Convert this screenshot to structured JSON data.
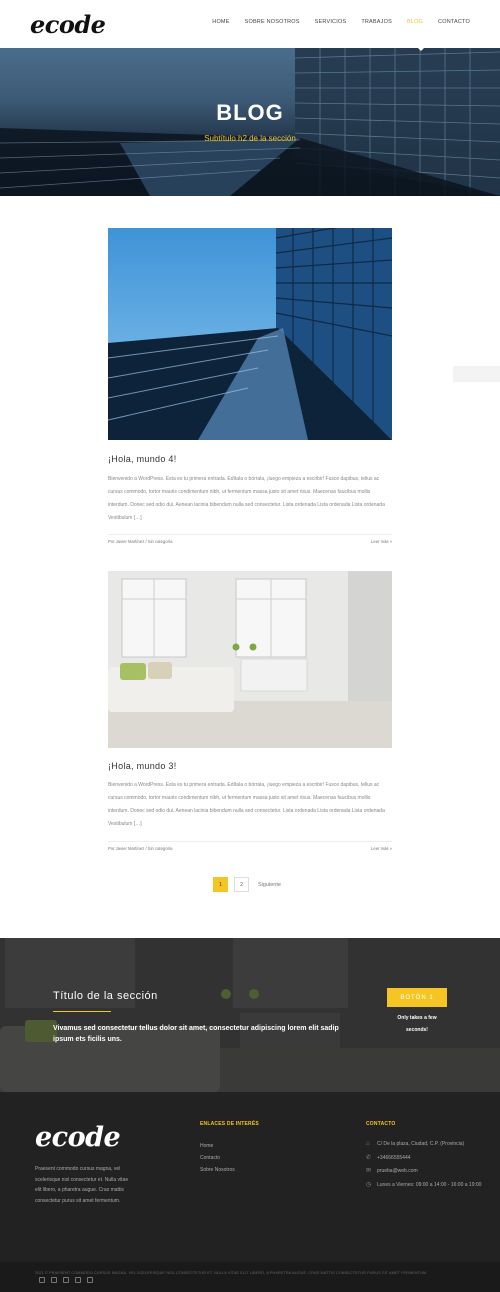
{
  "header": {
    "logo": "ecode",
    "nav": [
      "HOME",
      "SOBRE NOSOTROS",
      "SERVICIOS",
      "TRABAJOS",
      "BLOG",
      "CONTACTO"
    ],
    "active": "BLOG"
  },
  "hero": {
    "title": "BLOG",
    "subtitle": "Subtítulo h2 de la sección"
  },
  "posts": [
    {
      "title": "¡Hola, mundo 4!",
      "excerpt": "Bienvenido a WordPress. Esta es tu primera entrada. Edítala o bórrala, ¡luego empieza a escribir! Fusce dapibus, tellus ac cursus commodo, tortor mauris condimentum nibh, ut fermentum massa justo sit amet risus. Maecenas faucibus mollis interdum. Donec sed odio dui. Aenean lacinia bibendum nulla sed consectetur.   Lista ordenada Lista ordenada Lista ordenada   Vestibulum […]",
      "meta": "Por Javier Martínez / Sin categoría",
      "more": "Leer más »"
    },
    {
      "title": "¡Hola, mundo 3!",
      "excerpt": "Bienvenido a WordPress. Esta es tu primera entrada. Edítala o bórrala, ¡luego empieza a escribir! Fusce dapibus, tellus ac cursus commodo, tortor mauris condimentum nibh, ut fermentum massa justo sit amet risus. Maecenas faucibus mollis interdum. Donec sed odio dui. Aenean lacinia bibendum nulla sed consectetur.   Lista ordenada Lista ordenada Lista ordenada   Vestibulum […]",
      "meta": "Por Javier Martínez / Sin categoría",
      "more": "Leer más »"
    }
  ],
  "pagination": {
    "pages": [
      "1",
      "2"
    ],
    "current": "1",
    "next": "Siguiente"
  },
  "cta": {
    "title": "Título de la sección",
    "text": "Vivamus sed consectetur tellus dolor sit amet, consectetur adipiscing lorem elit sadip ipsum ets ficilis uns.",
    "button": "BOTÓN 1",
    "note": "Only takes a few seconds!"
  },
  "footer": {
    "logo": "ecode",
    "about": "Praesent commodo cursus magna, vel scelerisque nisl consectetur et. Nulla vitae elit libero, a pharetra augue. Cras mattis consectetur purus sit amet fermentum.",
    "links_heading": "ENLACES DE INTERÉS",
    "links": [
      "Home",
      "Contacto",
      "Sobre Nosotros"
    ],
    "contact_heading": "CONTACTO",
    "address": "C/ De la plaza, Ciudad, C.P. (Provincia)",
    "phone": "+34666555444",
    "email": "prueba@web.com",
    "hours": "Lunes a Viernes: 09:00 a 14:00 - 16:00 a 19:00",
    "copyright": "2021 © PRAESENT COMMODO CURSUS MAGNA, VEL SCELERISQUE NISL CONSECTETUR ET. NULLA VITAE ELIT LIBERO, A PHARETRA AUGUE. CRAS MATTIS CONSECTETUR PURUS SIT AMET FERMENTUM.",
    "socials": [
      "facebook-icon",
      "twitter-icon",
      "instagram-icon",
      "linkedin-icon",
      "youtube-icon"
    ]
  },
  "colors": {
    "accent": "#f5c524",
    "footer_bg": "#222222"
  }
}
